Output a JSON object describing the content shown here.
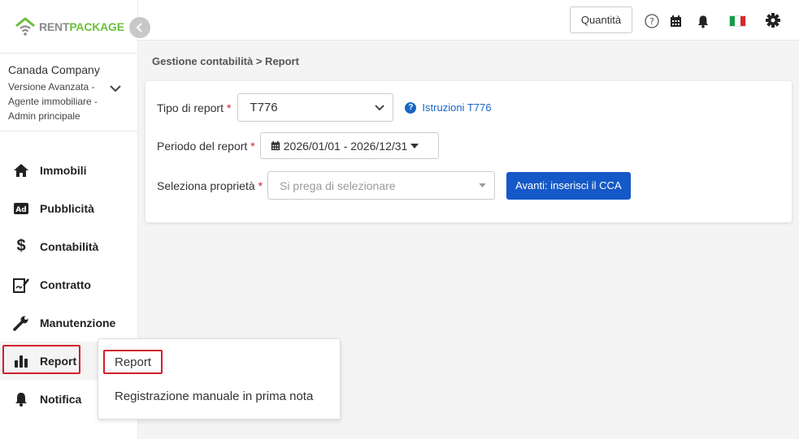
{
  "brand": {
    "rent": "RENT",
    "package": "PACKAGE",
    "accent": "#6cbf3c"
  },
  "company": {
    "name": "Canada Company",
    "subtitle": "Versione Avanzata - Agente immobiliare - Admin principale"
  },
  "sidebar": {
    "items": [
      {
        "label": "Immobili",
        "icon": "home-icon"
      },
      {
        "label": "Pubblicità",
        "icon": "ad-icon"
      },
      {
        "label": "Contabilità",
        "icon": "dollar-icon"
      },
      {
        "label": "Contratto",
        "icon": "contract-icon"
      },
      {
        "label": "Manutenzione",
        "icon": "wrench-icon"
      },
      {
        "label": "Report",
        "icon": "bar-chart-icon"
      },
      {
        "label": "Notifica",
        "icon": "bell-icon"
      }
    ]
  },
  "topbar": {
    "quantity_label": "Quantità",
    "icons": [
      "help-icon",
      "calendar-icon",
      "bell-icon",
      "italy-flag-icon",
      "gear-icon"
    ]
  },
  "breadcrumb": "Gestione contabilità > Report",
  "form": {
    "report_type_label": "Tipo di report",
    "report_type_value": "T776",
    "instructions_link": "Istruzioni T776",
    "period_label": "Periodo del report",
    "period_value": "2026/01/01 - 2026/12/31",
    "property_label": "Seleziona proprietà",
    "property_placeholder": "Si prega di selezionare",
    "next_button": "Avanti: inserisci il CCA",
    "required_mark": "*"
  },
  "dropdown": {
    "items": [
      "Report",
      "Registrazione manuale in prima nota"
    ]
  },
  "colors": {
    "primary": "#1558c7",
    "highlight": "#d0202a"
  }
}
